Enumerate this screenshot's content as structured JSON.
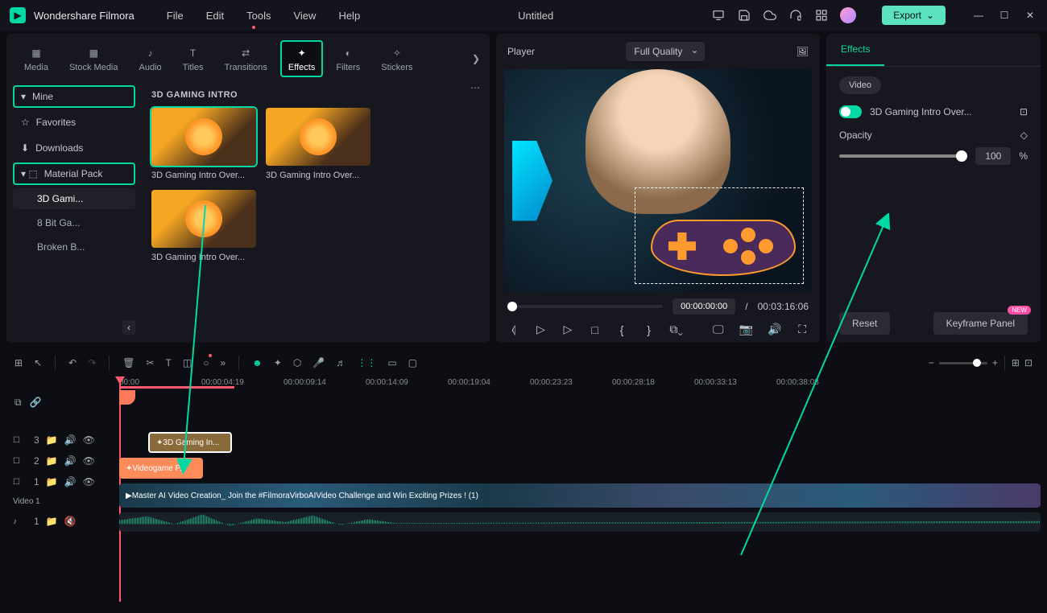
{
  "titlebar": {
    "app_name": "Wondershare Filmora",
    "menu": [
      "File",
      "Edit",
      "Tools",
      "View",
      "Help"
    ],
    "doc_title": "Untitled",
    "export_label": "Export"
  },
  "top_tabs": [
    {
      "id": "media",
      "label": "Media"
    },
    {
      "id": "stock",
      "label": "Stock Media"
    },
    {
      "id": "audio",
      "label": "Audio"
    },
    {
      "id": "titles",
      "label": "Titles"
    },
    {
      "id": "transitions",
      "label": "Transitions"
    },
    {
      "id": "effects",
      "label": "Effects"
    },
    {
      "id": "filters",
      "label": "Filters"
    },
    {
      "id": "stickers",
      "label": "Stickers"
    }
  ],
  "sidebar": {
    "mine": "Mine",
    "favorites": "Favorites",
    "downloads": "Downloads",
    "material_pack": "Material Pack",
    "subs": [
      "3D Gami...",
      "8 Bit Ga...",
      "Broken B..."
    ]
  },
  "grid": {
    "title": "3D GAMING INTRO",
    "items": [
      "3D Gaming Intro Over...",
      "3D Gaming Intro Over...",
      "3D Gaming Intro Over..."
    ]
  },
  "preview": {
    "player_label": "Player",
    "quality": "Full Quality",
    "time_current": "00:00:00:00",
    "time_sep": "/",
    "time_total": "00:03:16:06"
  },
  "right": {
    "tab_effects": "Effects",
    "pill_video": "Video",
    "effect_name": "3D Gaming Intro Over...",
    "opacity_label": "Opacity",
    "opacity_value": "100",
    "opacity_unit": "%",
    "reset": "Reset",
    "keyframe_panel": "Keyframe Panel",
    "new_badge": "NEW"
  },
  "timeline": {
    "ticks": [
      "00:00",
      "00:00:04:19",
      "00:00:09:14",
      "00:00:14:09",
      "00:00:19:04",
      "00:00:23:23",
      "00:00:28:18",
      "00:00:33:13",
      "00:00:38:08"
    ],
    "tracks": [
      {
        "id": "fx3",
        "name": "3"
      },
      {
        "id": "fx2",
        "name": "2"
      },
      {
        "id": "v1",
        "name": "1"
      },
      {
        "id": "v1label",
        "name": "Video 1"
      },
      {
        "id": "a1",
        "name": "1"
      }
    ],
    "clip_effect": "3D Gaming In...",
    "clip_effect2": "Videogame P...",
    "clip_video": "Master AI Video Creation_ Join the #FilmoraVirboAIVideo Challenge and Win Exciting Prizes ! (1)"
  }
}
